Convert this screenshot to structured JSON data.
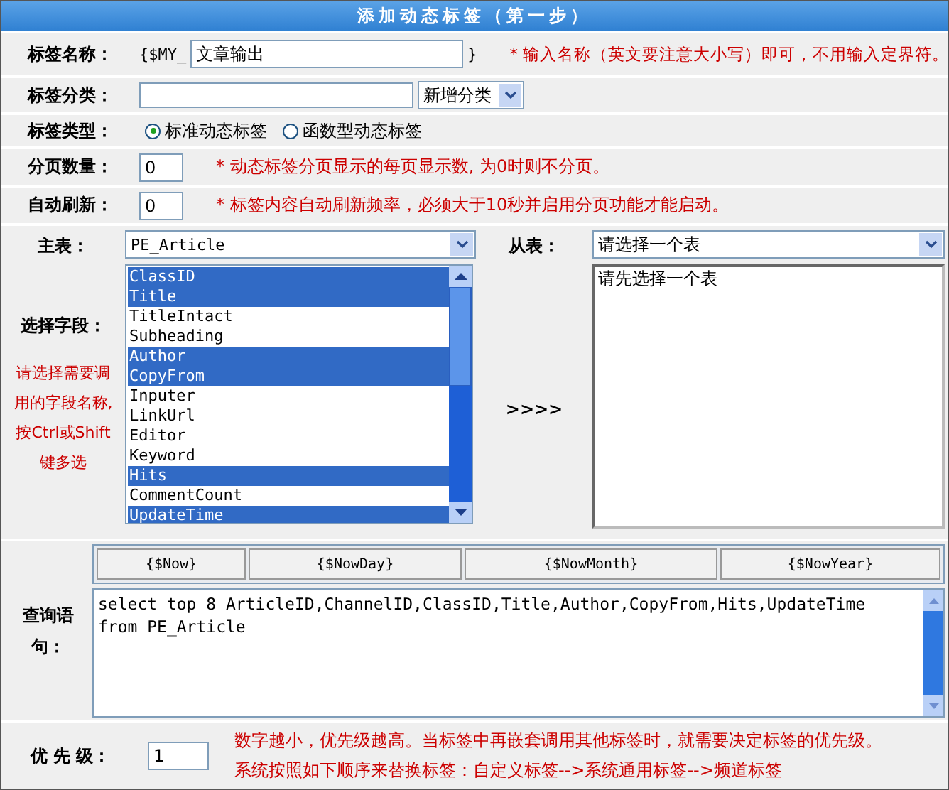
{
  "title": "添加动态标签（第一步）",
  "name_row": {
    "label": "标签名称：",
    "prefix": "{$MY_",
    "value": "文章输出",
    "suffix": "}",
    "hint": "* 输入名称（英文要注意大小写）即可，不用输入定界符。"
  },
  "category_row": {
    "label": "标签分类：",
    "select": "新增分类"
  },
  "type_row": {
    "label": "标签类型：",
    "options": [
      {
        "label": "标准动态标签",
        "selected": true
      },
      {
        "label": "函数型动态标签",
        "selected": false
      }
    ]
  },
  "page_row": {
    "label": "分页数量：",
    "value": "0",
    "hint": "* 动态标签分页显示的每页显示数, 为0时则不分页。"
  },
  "refresh_row": {
    "label": "自动刷新：",
    "value": "0",
    "hint": "* 标签内容自动刷新频率，必须大于10秒并启用分页功能才能启动。"
  },
  "tables": {
    "main_label": "主表：",
    "main_select": "PE_Article",
    "sub_label": "从表：",
    "sub_select": "请选择一个表",
    "fields_label": "选择字段：",
    "fields_hint": "请选择需要调用的字段名称,按Ctrl或Shift键多选",
    "arrow": ">>>>",
    "sub_list": "请先选择一个表",
    "fields": [
      {
        "label": "ClassID",
        "selected": true
      },
      {
        "label": "Title",
        "selected": true
      },
      {
        "label": "TitleIntact",
        "selected": false
      },
      {
        "label": "Subheading",
        "selected": false
      },
      {
        "label": "Author",
        "selected": true
      },
      {
        "label": "CopyFrom",
        "selected": true
      },
      {
        "label": "Inputer",
        "selected": false
      },
      {
        "label": "LinkUrl",
        "selected": false
      },
      {
        "label": "Editor",
        "selected": false
      },
      {
        "label": "Keyword",
        "selected": false
      },
      {
        "label": "Hits",
        "selected": true
      },
      {
        "label": "CommentCount",
        "selected": false
      },
      {
        "label": "UpdateTime",
        "selected": true
      }
    ]
  },
  "query": {
    "label": "查询语句：",
    "tokens": [
      "{$Now}",
      "{$NowDay}",
      "{$NowMonth}",
      "{$NowYear}"
    ],
    "lines": [
      "select top 8 ArticleID,ChannelID,ClassID,Title,Author,CopyFrom,Hits,UpdateTime",
      "from PE_Article"
    ]
  },
  "priority": {
    "label": "优 先 级：",
    "value": "1",
    "hints": [
      "数字越小，优先级越高。当标签中再嵌套调用其他标签时，就需要决定标签的优先级。",
      "系统按照如下顺序来替换标签：自定义标签-->系统通用标签-->频道标签"
    ]
  }
}
